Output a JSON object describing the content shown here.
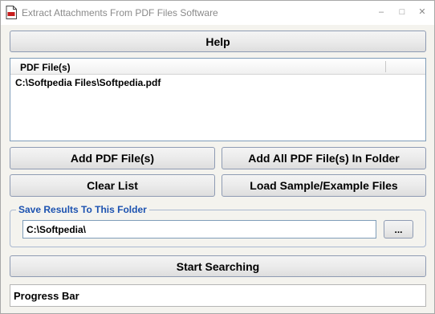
{
  "window": {
    "title": "Extract Attachments From PDF Files Software",
    "minimize_glyph": "–",
    "maximize_glyph": "□",
    "close_glyph": "✕"
  },
  "help_label": "Help",
  "file_list": {
    "column_header": "PDF File(s)",
    "rows": [
      "C:\\Softpedia Files\\Softpedia.pdf"
    ]
  },
  "buttons": {
    "add_files": "Add PDF File(s)",
    "add_folder": "Add All PDF File(s) In Folder",
    "clear_list": "Clear List",
    "load_sample": "Load Sample/Example Files",
    "browse": "...",
    "start": "Start Searching"
  },
  "save_group": {
    "label": "Save Results To This Folder",
    "folder_value": "C:\\Softpedia\\"
  },
  "progress": {
    "label": "Progress Bar",
    "value": 0
  },
  "colors": {
    "group_label": "#1c52b0",
    "button_border": "#8e9bb3",
    "window_bg": "#f4f3ee"
  },
  "icons": {
    "app": "pdf-document-icon"
  }
}
